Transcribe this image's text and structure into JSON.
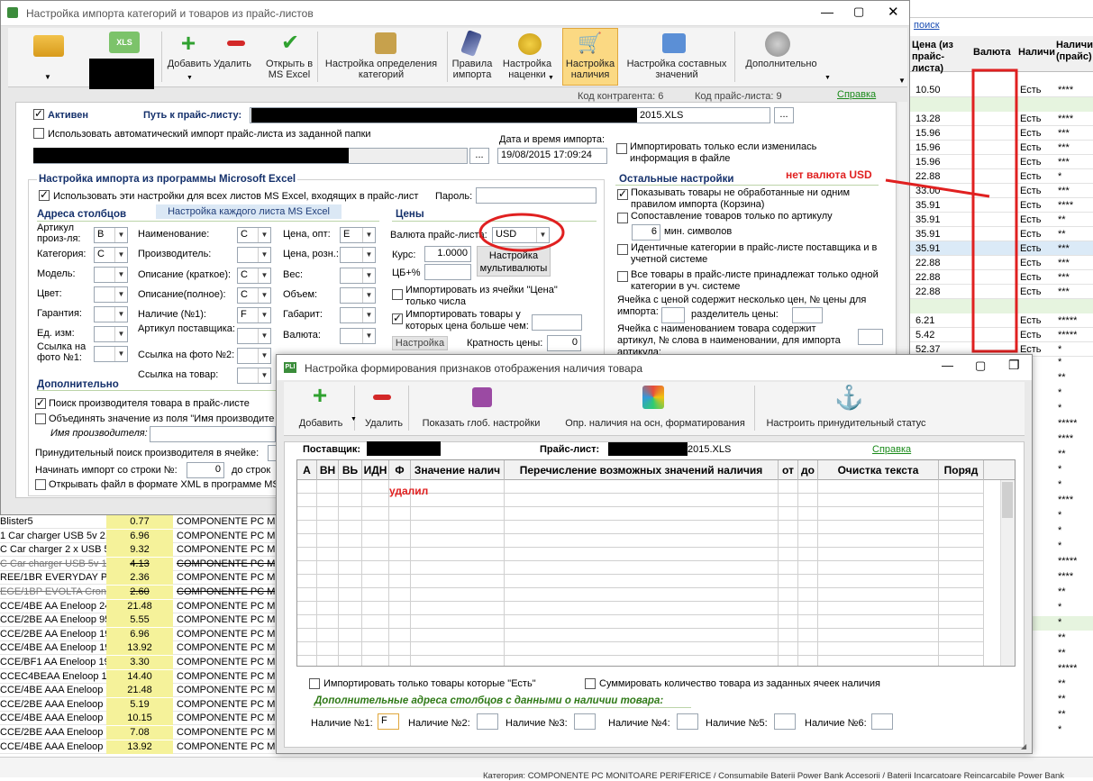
{
  "bg_right": {
    "search": "поиск",
    "col_price": "Цена (из прайс-листа)",
    "col_currency": "Валюта",
    "col_avail": "Наличи",
    "col_avail2": "Наличие (прайс)",
    "rows": [
      {
        "price": "10.50",
        "avail": "Есть",
        "st": "****"
      },
      {
        "price": "13.28",
        "avail": "Есть",
        "st": "****"
      },
      {
        "price": "15.96",
        "avail": "Есть",
        "st": "***"
      },
      {
        "price": "15.96",
        "avail": "Есть",
        "st": "***"
      },
      {
        "price": "15.96",
        "avail": "Есть",
        "st": "***"
      },
      {
        "price": "22.88",
        "avail": "Есть",
        "st": "*"
      },
      {
        "price": "33.00",
        "avail": "Есть",
        "st": "***"
      },
      {
        "price": "35.91",
        "avail": "Есть",
        "st": "****"
      },
      {
        "price": "35.91",
        "avail": "Есть",
        "st": "**"
      },
      {
        "price": "35.91",
        "avail": "Есть",
        "st": "**"
      },
      {
        "price": "35.91",
        "avail": "Есть",
        "st": "***"
      },
      {
        "price": "22.88",
        "avail": "Есть",
        "st": "***"
      },
      {
        "price": "22.88",
        "avail": "Есть",
        "st": "***"
      },
      {
        "price": "22.88",
        "avail": "Есть",
        "st": "***"
      },
      {
        "price": "6.21",
        "avail": "Есть",
        "st": "*****"
      },
      {
        "price": "5.42",
        "avail": "Есть",
        "st": "*****"
      },
      {
        "price": "52.37",
        "avail": "Есть",
        "st": "*"
      }
    ],
    "right_stars": [
      "*",
      "**",
      "*",
      "*",
      "*****",
      "****",
      "**",
      "*",
      "*",
      "****",
      "*",
      "*",
      "*",
      "*****",
      "****",
      "**",
      "*",
      "*",
      "**",
      "**",
      "*****",
      "**",
      "**",
      "**",
      "*"
    ]
  },
  "bg_bottom": {
    "rows": [
      {
        "name": "Blister5",
        "price": "0.77",
        "cat": "COMPONENTE PC MON"
      },
      {
        "name": "1 Car charger USB 5v 2.",
        "price": "6.96",
        "cat": "COMPONENTE PC MON"
      },
      {
        "name": "C Car charger 2 x USB 5v",
        "price": "9.32",
        "cat": "COMPONENTE PC MON"
      },
      {
        "name": "C Car charger USB 5v 1A,",
        "price": "4.13",
        "cat": "COMPONENTE PC MON",
        "strike": true
      },
      {
        "name": "REE/1BR EVERYDAY Powe",
        "price": "2.36",
        "cat": "COMPONENTE PC MON"
      },
      {
        "name": "EGE/1BP EVOLTA Crona S",
        "price": "2.60",
        "cat": "COMPONENTE PC MON",
        "strike": true
      },
      {
        "name": "CCE/4BE AA Eneloop 245",
        "price": "21.48",
        "cat": "COMPONENTE PC MON"
      },
      {
        "name": "CCE/2BE AA Eneloop 950n",
        "price": "5.55",
        "cat": "COMPONENTE PC MON"
      },
      {
        "name": "CCE/2BE AA Eneloop 190",
        "price": "6.96",
        "cat": "COMPONENTE PC MON"
      },
      {
        "name": "CCE/4BE AA Eneloop 190",
        "price": "13.92",
        "cat": "COMPONENTE PC MON"
      },
      {
        "name": "CCE/BF1 AA Eneloop 190",
        "price": "3.30",
        "cat": "COMPONENTE PC MON"
      },
      {
        "name": "CCEC4BEAA Eneloop 190",
        "price": "14.40",
        "cat": "COMPONENTE PC MON"
      },
      {
        "name": "CCE/4BE AAA Eneloop 90",
        "price": "21.48",
        "cat": "COMPONENTE PC MON"
      },
      {
        "name": "CCE/2BE AAA Eneloop 55",
        "price": "5.19",
        "cat": "COMPONENTE PC MON"
      },
      {
        "name": "CCE/4BE AAA Eneloop 55",
        "price": "10.15",
        "cat": "COMPONENTE PC MON"
      },
      {
        "name": "CCE/2BE AAA Eneloop 75",
        "price": "7.08",
        "cat": "COMPONENTE PC MON"
      },
      {
        "name": "CCE/4BE AAA Eneloop 75",
        "price": "13.92",
        "cat": "COMPONENTE PC MON"
      }
    ],
    "footer": "Категория: COMPONENTE PC MONITOARE PERIFERICE / Consumabile Baterii Power Bank Accesorii / Baterii Incarcatoare Reincarcabile Power Bank"
  },
  "main": {
    "title": "Настройка импорта категорий и товаров из прайс-листов",
    "toolbar": [
      {
        "label": "Добавить"
      },
      {
        "label": "Удалить"
      },
      {
        "label": "Открыть в MS Excel"
      },
      {
        "label": "Настройка определения категорий"
      },
      {
        "label": "Правила импорта"
      },
      {
        "label": "Настройка наценки"
      },
      {
        "label": "Настройка наличия"
      },
      {
        "label": "Настройка составных значений"
      },
      {
        "label": "Дополнительно"
      }
    ],
    "xls_label": "XLS",
    "info": {
      "contr_code": "Код контрагента: 6",
      "price_code": "Код прайс-листа: 9",
      "help": "Справка"
    },
    "active": "Активен",
    "path_label": "Путь к прайс-листу:",
    "path_value": "2015.XLS",
    "auto_import": "Использовать автоматический импорт прайс-листа из заданной папки",
    "date_label": "Дата и время импорта:",
    "date_value": "19/08/2015 17:09:24",
    "only_changed": "Импортировать только если изменилась информация в файле",
    "excel_group": "Настройка импорта из программы Microsoft Excel",
    "use_all": "Использовать эти настройки для всех листов MS Excel, входящих в прайс-лист",
    "password": "Пароль:",
    "each_sheet": "Настройка каждого листа MS Excel",
    "cols_title": "Адреса столбцов",
    "fields_left": [
      {
        "label": "Артикул произ-ля:",
        "value": "B"
      },
      {
        "label": "Категория:",
        "value": "C"
      },
      {
        "label": "Модель:",
        "value": ""
      },
      {
        "label": "Цвет:",
        "value": ""
      },
      {
        "label": "Гарантия:",
        "value": ""
      },
      {
        "label": "Ед. изм:",
        "value": ""
      },
      {
        "label": "Ссылка на фото №1:",
        "value": ""
      }
    ],
    "fields_mid": [
      {
        "label": "Наименование:",
        "value": "C"
      },
      {
        "label": "Производитель:",
        "value": ""
      },
      {
        "label": "Описание (краткое):",
        "value": "C"
      },
      {
        "label": "Описание(полное):",
        "value": "C"
      },
      {
        "label": "Наличие (№1):",
        "value": "F"
      },
      {
        "label": "Артикул поставщика:",
        "value": ""
      },
      {
        "label": "Ссылка на фото №2:",
        "value": ""
      },
      {
        "label": "Ссылка на товар:",
        "value": ""
      }
    ],
    "fields_right": [
      {
        "label": "Цена, опт:",
        "value": "E"
      },
      {
        "label": "Цена, розн.:",
        "value": ""
      },
      {
        "label": "Вес:",
        "value": ""
      },
      {
        "label": "Объем:",
        "value": ""
      },
      {
        "label": "Габарит:",
        "value": ""
      },
      {
        "label": "Валюта:",
        "value": ""
      }
    ],
    "prices_title": "Цены",
    "currency_label": "Валюта прайс-листа:",
    "currency_value": "USD",
    "rate_label": "Курс:",
    "rate_value": "1.0000",
    "cb_label": "ЦБ+%",
    "multi_btn": "Настройка мультивалюты",
    "import_price_cell": "Импортировать из ячейки \"Цена\" только числа",
    "import_qty": "Импортировать товары у которых цена больше чем:",
    "setup_btn": "Настройка",
    "mult_label": "Кратность цены:",
    "mult_value": "0",
    "other_title": "Остальные настройки",
    "other": [
      {
        "text": "Показывать товары не обработанные ни одним правилом импорта (Корзина)",
        "on": true
      },
      {
        "text": "Сопоставление товаров только по артикулу",
        "on": false
      },
      {
        "text": "Идентичные категории в прайс-листе поставщика и в учетной системе",
        "on": false
      },
      {
        "text": "Все товары в прайс-листе принадлежат только одной категории в уч. системе",
        "on": false
      }
    ],
    "min_sym_value": "6",
    "min_sym": "мин. символов",
    "multi_price": "Ячейка с ценой содержит несколько цен, № цены для импорта:",
    "separator": "разделитель цены:",
    "multi_name": "Ячейка с наименованием товара содержит артикул, № слова в наименовании, для импорта артикула:",
    "extra_title": "Дополнительно",
    "search_manuf": "Поиск производителя товара в прайс-листе",
    "merge_field": "Объединять значение из поля \"Имя производите",
    "manuf_name": "Имя производителя:",
    "force_search": "Принудительный поиск производителя в ячейке:",
    "start_row": "Начинать импорт со строки №:",
    "start_row_value": "0",
    "start_row_to": "до строк",
    "open_xml": "Открывать файл в формате XML в программе MS"
  },
  "annotations": {
    "no_usd": "нет валюта USD",
    "deleted": "удалил"
  },
  "dialog": {
    "title": "Настройка формирования признаков отображения наличия товара",
    "app_icon": "PLI",
    "toolbar": [
      {
        "label": "Добавить"
      },
      {
        "label": "Удалить"
      },
      {
        "label": "Показать глоб. настройки"
      },
      {
        "label": "Опр. наличия на осн, форматирования"
      },
      {
        "label": "Настроить принудительный статус"
      }
    ],
    "supplier": "Поставщик:",
    "pricelist": "Прайс-лист:",
    "pricelist_value": "2015.XLS",
    "help": "Справка",
    "columns": [
      "А",
      "ВН",
      "ВЬ",
      "ИДН",
      "Ф",
      "Значение налич",
      "Перечисление возможных значений наличия",
      "от",
      "до",
      "Очистка текста",
      "Поряд"
    ],
    "only_yes": "Импортировать только товары которые \"Есть\"",
    "sum_qty": "Суммировать количество товара из заданных ячеек наличия",
    "addr_title": "Дополнительные адреса столбцов с данными о наличии товара:",
    "avail": [
      {
        "label": "Наличие №1:",
        "value": "F"
      },
      {
        "label": "Наличие №2:",
        "value": ""
      },
      {
        "label": "Наличие №3:",
        "value": ""
      },
      {
        "label": "Наличие №4:",
        "value": ""
      },
      {
        "label": "Наличие №5:",
        "value": ""
      },
      {
        "label": "Наличие №6:",
        "value": ""
      }
    ]
  },
  "colors": {
    "accent": "#14306b",
    "annotation": "#e02020",
    "price_bg": "#f5f29a",
    "link": "#1a8a1a"
  }
}
